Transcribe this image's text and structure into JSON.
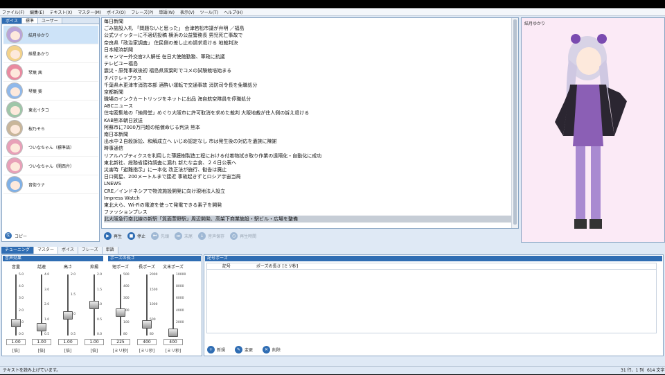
{
  "menu": [
    "ファイル(F)",
    "編集(E)",
    "テキスト(X)",
    "マスター(M)",
    "ボイス(O)",
    "フレーズ(P)",
    "単語(W)",
    "表示(V)",
    "ツール(T)",
    "ヘルプ(H)"
  ],
  "left_tabs": {
    "head": "ボイス",
    "tab1": "標準",
    "tab2": "ユーザー"
  },
  "characters": [
    {
      "name": "結月ゆかり",
      "color": "#b9a3d8"
    },
    {
      "name": "紲星あかり",
      "color": "#f3d28a"
    },
    {
      "name": "琴葉 茜",
      "color": "#e98aa0"
    },
    {
      "name": "琴葉 葵",
      "color": "#8fb8ea"
    },
    {
      "name": "東北イタコ",
      "color": "#9ec6a8"
    },
    {
      "name": "桜乃そら",
      "color": "#c9b69a"
    },
    {
      "name": "ついなちゃん（標準語）",
      "color": "#e8a0b8"
    },
    {
      "name": "ついなちゃん（関西弁）",
      "color": "#e8a0b8"
    },
    {
      "name": "音街ウナ",
      "color": "#7fb0e6"
    }
  ],
  "copy_label": "コピー",
  "text_lines": [
    "毎日新聞",
    "ごみ施設入札 「問題ないと思った」 会津若松市議が弁明 ／福島",
    "公式ツイッターに不適切投稿 横浜の公益警務長 男児死亡事故で",
    "奈良県「政治家調査」 住民側の差し止め請求退ける 地裁判決",
    "日本経済新聞",
    "ミャンマー外交官2人解任 在日大使館勤務、軍政に抗議",
    "テレビユー福島",
    "震災・原発事故後初 福島県双葉町でコメの試験栽培始まる",
    "チバテレ+プラス",
    "千葉県木更津市消防本部 酒酔い運転で交通事故 消防司令長を免職処分",
    "京都新聞",
    "職場のインクカートリッジをネットに出品 海自航空隊員を停職処分",
    "ABCニュース",
    "住宅密集地の「納骨堂」めぐり大阪市に許可取消を求めた裁判 大阪地裁が住人側の訴え退ける",
    "KAB熊本朝日放送",
    "阿蘇市に7000万円超の賠償命じる判決 熊本",
    "南日本新聞",
    "出水中２自殺訴訟、和解成立へ いじめ認定なし 市は発生後の対応を遺族に陳謝",
    "時事通信",
    "リアルハプティクスを利用した薄膜樹製造工程における付着物拭き取り作業の遠隔化・自動化に成功",
    "東北新社、総務省接待調査に漏れ 新たな会食、２４日公表へ",
    "災害時「避難指示」に一本化 改正法が施行、勧告は廃止",
    "日口衛星、200メートルまで接近 事故起きずとロシア宇宙当局",
    "LNEWS",
    "CRE／インドネシアで物流施設開発に向け現地法人設立",
    "Impress Watch",
    "東北大ら、Wi-Fiの電波を使って発電できる素子を開発",
    "ファッションプレス",
    "北大阪急行南北線の新駅「箕面萱野駅」周辺開発、高架下商業施設・駅ビル・広場を整備"
  ],
  "play_buttons": {
    "play": "再生",
    "stop": "停止",
    "head": "先頭",
    "tail": "末尾",
    "save": "音声保存",
    "time": "再生時間"
  },
  "character_panel_name": "結月ゆかり",
  "bottom_tabs": {
    "head": "チューニング",
    "t1": "マスター",
    "t2": "ボイス",
    "t3": "フレーズ",
    "t4": "単語"
  },
  "voice_effect_title": "音声効果",
  "pause_length_title": "ポーズの長さ",
  "sliders": [
    {
      "label": "音量",
      "value": "1.00",
      "unit": "[倍]",
      "ticks": [
        "5.0",
        "4.0",
        "3.0",
        "2.0",
        "1.0",
        "0.0"
      ],
      "level": 0.2
    },
    {
      "label": "話速",
      "value": "1.00",
      "unit": "[倍]",
      "ticks": [
        "4.0",
        "3.0",
        "2.0",
        "1.0",
        "0.5"
      ],
      "level": 0.14
    },
    {
      "label": "高さ",
      "value": "1.00",
      "unit": "[倍]",
      "ticks": [
        "2.0",
        "1.5",
        "1.0",
        "0.5"
      ],
      "level": 0.33
    },
    {
      "label": "抑揚",
      "value": "1.00",
      "unit": "[倍]",
      "ticks": [
        "2.0",
        "1.5",
        "1.0",
        "0.5",
        "0.0"
      ],
      "level": 0.5
    },
    {
      "label": "短ポーズ",
      "value": "225",
      "unit": "[ミリ秒]",
      "ticks": [
        "500",
        "400",
        "300",
        "200",
        "100",
        "80"
      ],
      "level": 0.38
    },
    {
      "label": "長ポーズ",
      "value": "400",
      "unit": "[ミリ秒]",
      "ticks": [
        "2000",
        "1500",
        "1000",
        "500",
        "80"
      ],
      "level": 0.18
    },
    {
      "label": "文末ポーズ",
      "value": "400",
      "unit": "[ミリ秒]",
      "ticks": [
        "10000",
        "8000",
        "6000",
        "4000",
        "2000",
        "0"
      ],
      "level": 0.04
    }
  ],
  "symbol_pause": {
    "title": "記号ポーズ",
    "col1": "記号",
    "col2": "ポーズの長さ [ミリ秒]"
  },
  "pause_buttons": {
    "new": "新規",
    "edit": "変更",
    "delete": "削除"
  },
  "status": {
    "left": "テキストを読み上げています。",
    "pos": "31 行、1 列",
    "count": "614 文字"
  }
}
